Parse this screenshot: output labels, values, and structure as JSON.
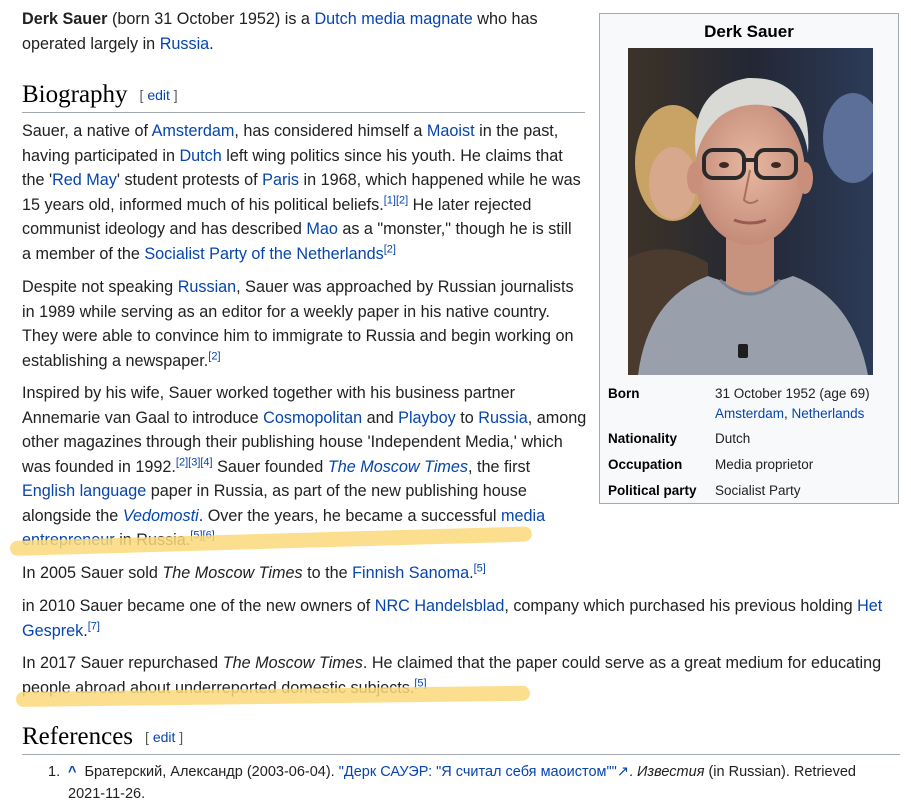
{
  "intro": {
    "name": "Derk Sauer",
    "t1": " (born 31 October 1952) is a ",
    "l1": "Dutch media magnate",
    "t2": " who has operated largely in ",
    "l2": "Russia",
    "t3": "."
  },
  "biography_heading": {
    "title": "Biography",
    "bracket_open": "[ ",
    "edit": "edit",
    "bracket_close": " ]"
  },
  "bio_p1": {
    "t1": "Sauer, a native of ",
    "l1": "Amsterdam",
    "t2": ", has considered himself a ",
    "l2": "Maoist",
    "t3": " in the past, having participated in ",
    "l3": "Dutch",
    "t4": " left wing politics since his youth. He claims that the '",
    "l4": "Red May",
    "t5": "' student protests of ",
    "l5": "Paris",
    "t6": " in 1968, which happened while he was 15 years old, informed much of his political beliefs.",
    "c1": "[1]",
    "c2": "[2]",
    "t7": " He later rejected communist ideology and has described ",
    "l6": "Mao",
    "t8": " as a \"monster,\" though he is still a member of the ",
    "l7": "Socialist Party of the Netherlands",
    "c3": "[2]"
  },
  "bio_p2": {
    "t1": "Despite not speaking ",
    "l1": "Russian",
    "t2": ", Sauer was approached by Russian journalists in 1989 while serving as an editor for a weekly paper in his native country. They were able to convince him to immigrate to Russia and begin working on establishing a newspaper.",
    "c1": "[2]"
  },
  "bio_p3": {
    "t1": "Inspired by his wife, Sauer worked together with his business partner Annemarie van Gaal to introduce ",
    "l1": "Cosmopolitan",
    "t2": " and ",
    "l2": "Playboy",
    "t3": " to ",
    "l3": "Russia",
    "t4": ", among other magazines through their publishing house 'Independent Media,' which was founded in 1992.",
    "c1": "[2]",
    "c2": "[3]",
    "c3": "[4]",
    "t5": " Sauer founded ",
    "l4": "The Moscow Times",
    "t6": ", the first ",
    "l5": "English language",
    "t7": " paper in Russia, as part of the new publishing house alongside the ",
    "l6": "Vedomosti",
    "t8": ". Over the years, he became a successful ",
    "l7": "media entrepreneur",
    "t9": " in Russia.",
    "c4": "[5]",
    "c5": "[6]"
  },
  "bio_p4": {
    "t1": "In 2005 Sauer sold ",
    "i1": "The Moscow Times",
    "t2": " to the ",
    "l1": "Finnish Sanoma",
    "t3": ".",
    "c1": "[5]"
  },
  "bio_p5": {
    "t1": "in 2010 Sauer became one of the new owners of ",
    "l1": "NRC Handelsblad",
    "t2": ", company which purchased his previous holding ",
    "l2": "Het Gesprek",
    "t3": ".",
    "c1": "[7]"
  },
  "bio_p6": {
    "t1": "In 2017 Sauer repurchased ",
    "i1": "The Moscow Times",
    "t2": ". He claimed that the paper could serve as a great medium for educating people abroad about underreported domestic subjects.",
    "c1": "[5]"
  },
  "references_heading": {
    "title": "References",
    "bracket_open": "[ ",
    "edit": "edit",
    "bracket_close": " ]"
  },
  "references": [
    {
      "num": "1.",
      "caret": "^",
      "author": " Братерский, Александр (2003-06-04). ",
      "link": "\"Дерк САУЭР: \"Я считал себя маоистом\"\"",
      "ext_icon": "↗",
      "t1": ". ",
      "work": "Известия",
      "t2": " (in Russian). Retrieved 2021-11-26."
    }
  ],
  "infobox": {
    "title": "Derk Sauer",
    "born_label": "Born",
    "born_date": "31 October 1952 (age 69)",
    "born_place_city": "Amsterdam",
    "born_place_sep": ", ",
    "born_place_country": "Netherlands",
    "nationality_label": "Nationality",
    "nationality": "Dutch",
    "occupation_label": "Occupation",
    "occupation": "Media proprietor",
    "party_label": "Political party",
    "party": "Socialist Party"
  },
  "colors": {
    "link": "#0645ad",
    "highlight": "#fcd97a",
    "infobox_bg": "#f8f9fa"
  }
}
